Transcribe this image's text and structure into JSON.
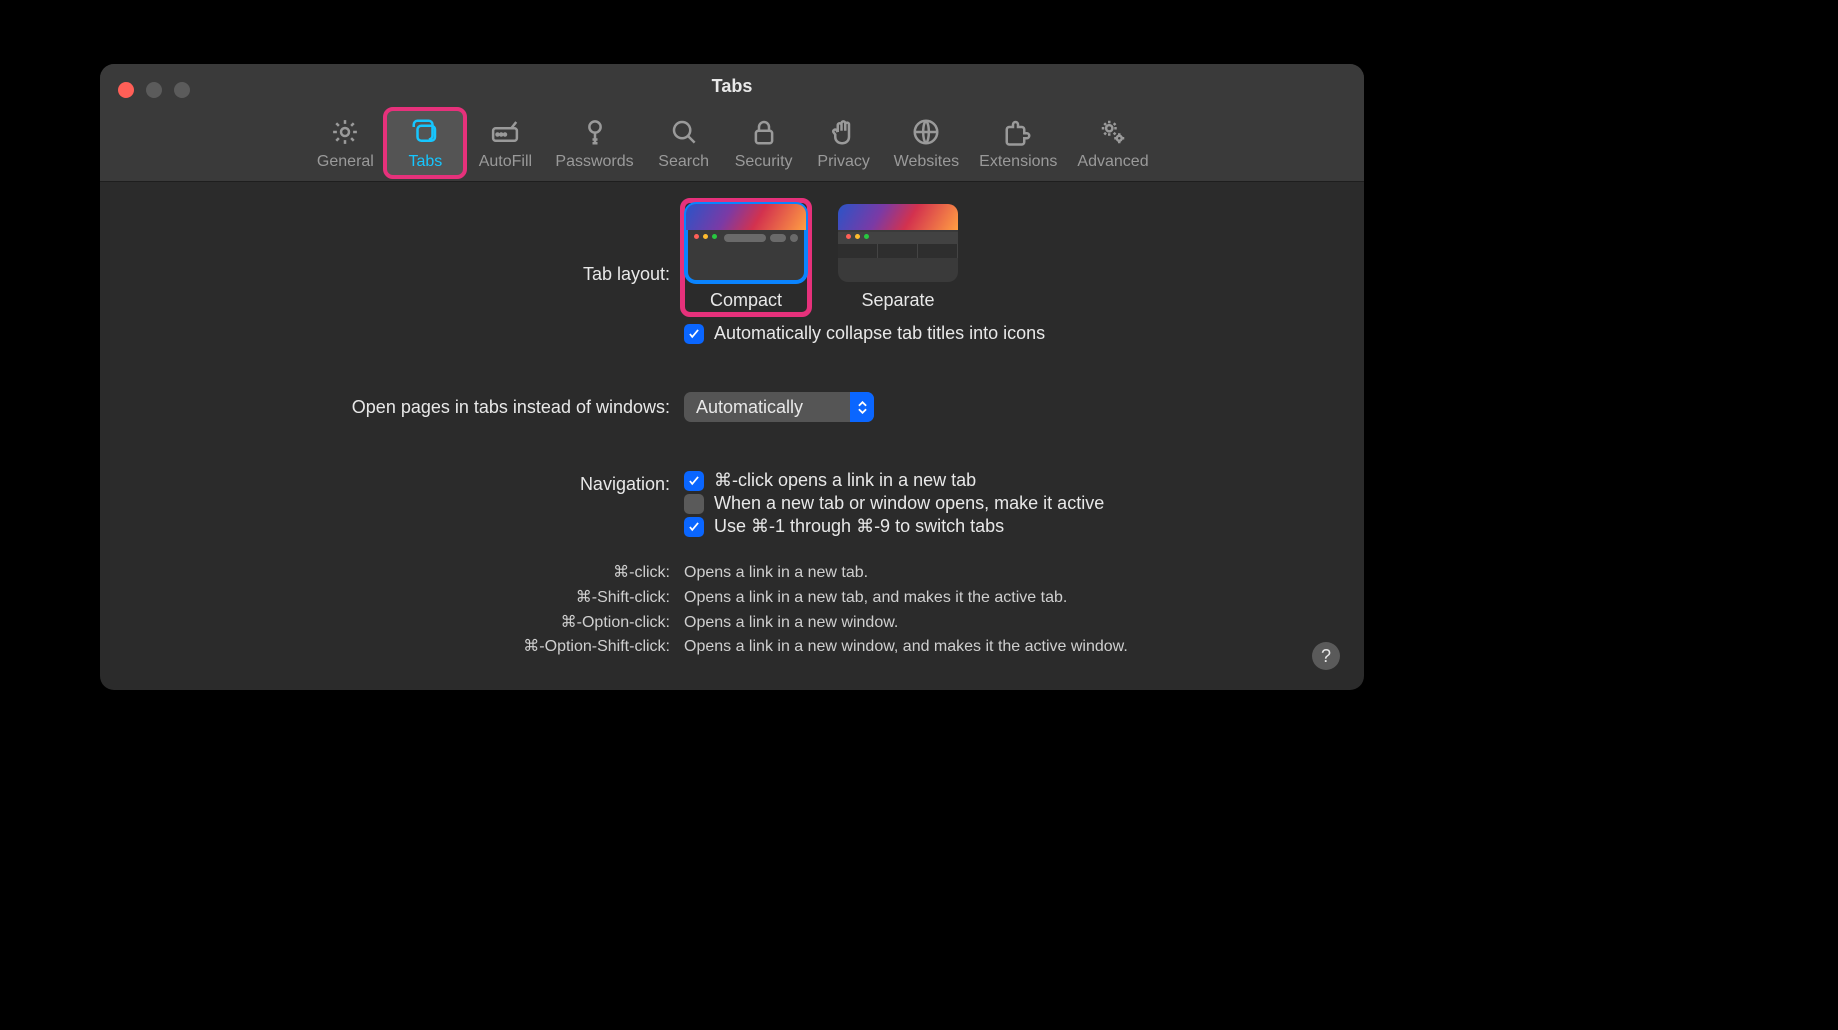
{
  "window": {
    "title": "Tabs"
  },
  "colors": {
    "accent": "#0a84ff",
    "highlight": "#e6317b",
    "tab_active": "#16c6ff"
  },
  "toolbar": {
    "items": [
      {
        "id": "general",
        "label": "General"
      },
      {
        "id": "tabs",
        "label": "Tabs",
        "selected": true
      },
      {
        "id": "autofill",
        "label": "AutoFill"
      },
      {
        "id": "passwords",
        "label": "Passwords"
      },
      {
        "id": "search",
        "label": "Search"
      },
      {
        "id": "security",
        "label": "Security"
      },
      {
        "id": "privacy",
        "label": "Privacy"
      },
      {
        "id": "websites",
        "label": "Websites"
      },
      {
        "id": "extensions",
        "label": "Extensions"
      },
      {
        "id": "advanced",
        "label": "Advanced"
      }
    ]
  },
  "main": {
    "tab_layout": {
      "label": "Tab layout:",
      "options": [
        {
          "id": "compact",
          "label": "Compact",
          "selected": true,
          "highlighted": true
        },
        {
          "id": "separate",
          "label": "Separate",
          "selected": false,
          "highlighted": false
        }
      ],
      "auto_collapse": {
        "label": "Automatically collapse tab titles into icons",
        "checked": true
      }
    },
    "open_pages": {
      "label": "Open pages in tabs instead of windows:",
      "value": "Automatically"
    },
    "navigation": {
      "label": "Navigation:",
      "items": [
        {
          "label": "⌘-click opens a link in a new tab",
          "checked": true
        },
        {
          "label": "When a new tab or window opens, make it active",
          "checked": false
        },
        {
          "label": "Use ⌘-1 through ⌘-9 to switch tabs",
          "checked": true
        }
      ]
    },
    "help": [
      {
        "key": "⌘-click:",
        "value": "Opens a link in a new tab."
      },
      {
        "key": "⌘-Shift-click:",
        "value": "Opens a link in a new tab, and makes it the active tab."
      },
      {
        "key": "⌘-Option-click:",
        "value": "Opens a link in a new window."
      },
      {
        "key": "⌘-Option-Shift-click:",
        "value": "Opens a link in a new window, and makes it the active window."
      }
    ],
    "help_button": "?"
  }
}
